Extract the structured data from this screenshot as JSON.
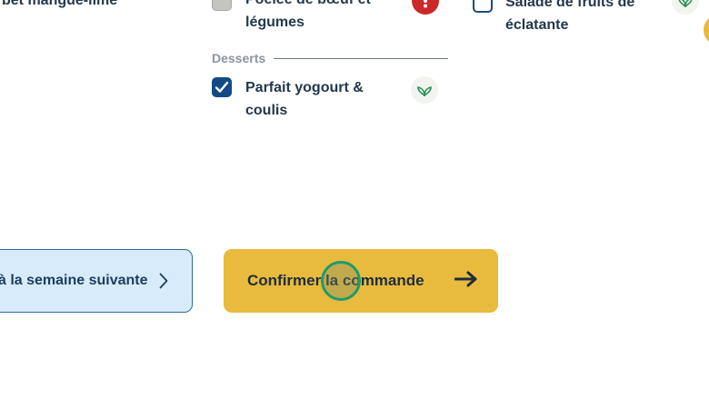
{
  "menu": {
    "left_column": {
      "item_label": "orbet mangue-lime"
    },
    "middle_column": {
      "main_item": {
        "label": "Poêlée de bœuf et légumes",
        "checked": false,
        "disabled": true,
        "badge": "alert-icon"
      },
      "desserts": {
        "title": "Desserts",
        "item": {
          "label": "Parfait yogourt & coulis",
          "checked": true,
          "badge": "leaf-icon"
        }
      }
    },
    "right_column": {
      "item": {
        "label": "Salade de fruits de éclatante",
        "checked": false,
        "badge": "leaf-icon"
      }
    }
  },
  "actions": {
    "next_week_label": "à la semaine suivante",
    "confirm_label": "Confirmer la commande"
  },
  "colors": {
    "accent_yellow": "#e8bb3e",
    "checkbox_blue": "#134a86",
    "alert_red": "#cc2a2a",
    "next_button_bg": "#d8ebfb"
  }
}
